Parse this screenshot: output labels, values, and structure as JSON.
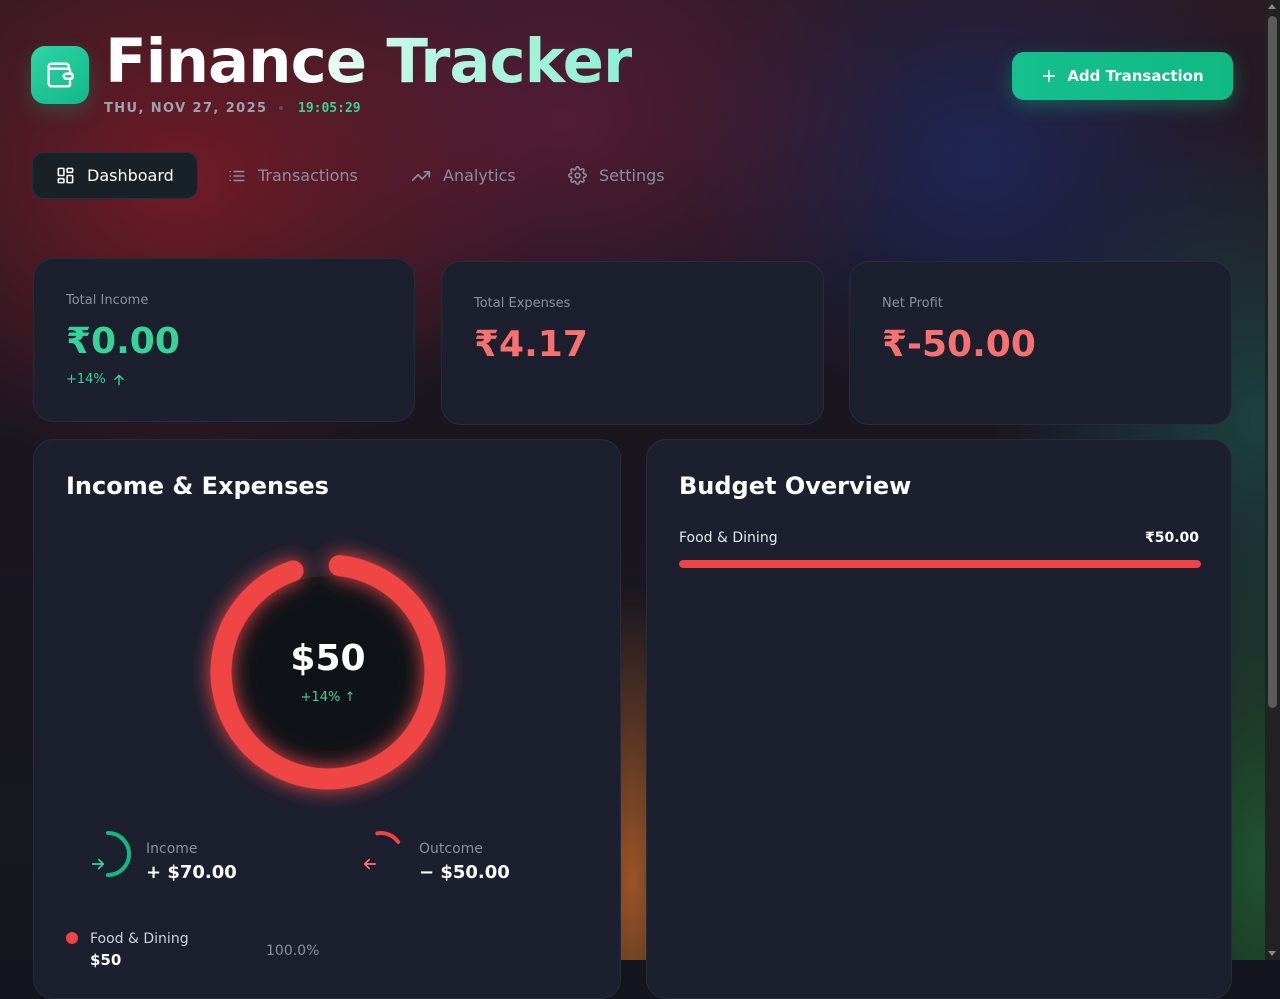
{
  "app": {
    "title": "Finance Tracker",
    "date": "THU, NOV 27, 2025",
    "time": "19:05:29",
    "logo_icon": "wallet-icon",
    "add_button_label": "Add Transaction"
  },
  "nav": {
    "items": [
      {
        "label": "Dashboard",
        "icon": "dashboard-grid-icon",
        "active": true
      },
      {
        "label": "Transactions",
        "icon": "list-icon",
        "active": false
      },
      {
        "label": "Analytics",
        "icon": "trending-up-icon",
        "active": false
      },
      {
        "label": "Settings",
        "icon": "gear-icon",
        "active": false
      }
    ]
  },
  "stats": {
    "income": {
      "label": "Total Income",
      "value": "₹0.00",
      "change": "+14%"
    },
    "expenses": {
      "label": "Total Expenses",
      "value": "₹4.17"
    },
    "profit": {
      "label": "Net Profit",
      "value": "₹-50.00"
    }
  },
  "income_expenses": {
    "title": "Income & Expenses",
    "center_value": "$50",
    "center_change": "+14% ↑",
    "ring_fraction": 0.93,
    "income": {
      "label": "Income",
      "value": "+ $70.00",
      "arc_fraction": 0.5
    },
    "outcome": {
      "label": "Outcome",
      "value": "− $50.00",
      "arc_fraction": 0.18
    },
    "breakdown": [
      {
        "label": "Food & Dining",
        "value": "$50",
        "percent": "100.0%",
        "color": "#ef4444"
      }
    ]
  },
  "budget": {
    "title": "Budget Overview",
    "items": [
      {
        "label": "Food & Dining",
        "amount": "₹50.00",
        "fraction": 1.0,
        "color": "#ef4444"
      }
    ]
  },
  "colors": {
    "accent": "#10b981",
    "positive": "#34d399",
    "negative": "#f87171",
    "ring": "#ef4444"
  }
}
